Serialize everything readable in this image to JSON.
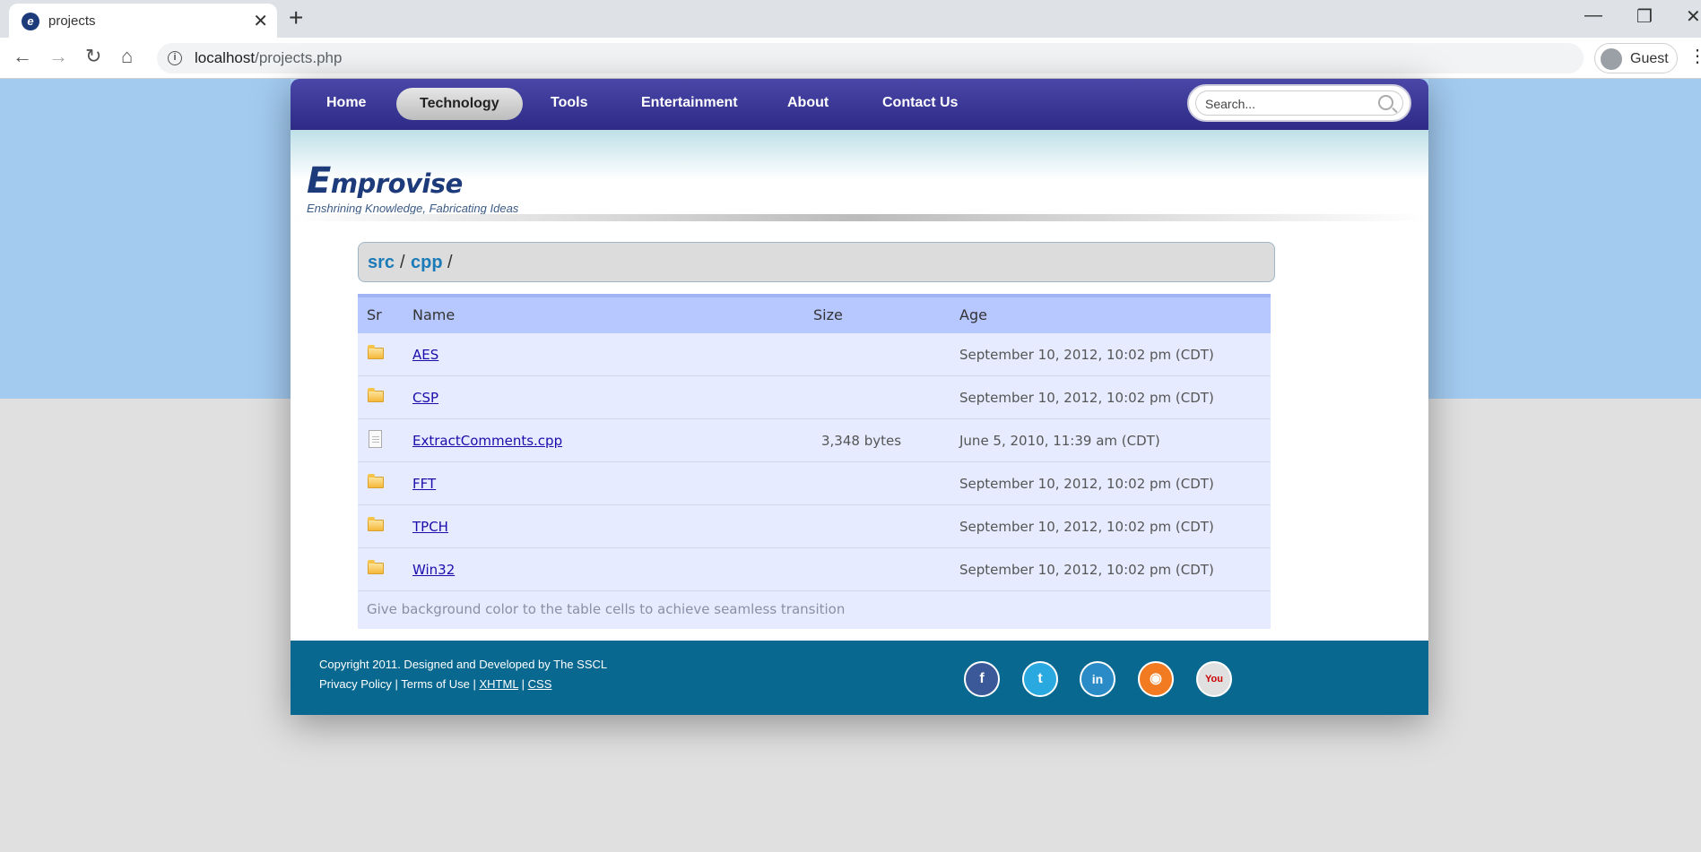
{
  "browser": {
    "tab_title": "projects",
    "favicon_letter": "e",
    "new_tab": "+",
    "url_host": "localhost",
    "url_path": "/projects.php",
    "profile_label": "Guest",
    "back": "←",
    "forward": "→",
    "reload": "↻",
    "home": "⌂",
    "close": "✕",
    "minimize": "—",
    "restore": "❐",
    "window_close": "✕",
    "menu": "⋮",
    "info": "i"
  },
  "nav": {
    "items": [
      "Home",
      "Technology",
      "Tools",
      "Entertainment",
      "About",
      "Contact Us"
    ],
    "active": "Technology",
    "search_placeholder": "Search..."
  },
  "header": {
    "logo_first": "E",
    "logo_rest": "mprovise",
    "tagline": "Enshrining Knowledge, Fabricating Ideas"
  },
  "breadcrumb": {
    "parts": [
      "src",
      "cpp"
    ],
    "separator": "/"
  },
  "table": {
    "headers": {
      "sr": "Sr",
      "name": "Name",
      "size": "Size",
      "age": "Age"
    },
    "rows": [
      {
        "type": "folder",
        "name": "AES",
        "size": "",
        "age": "September 10, 2012, 10:02 pm (CDT)"
      },
      {
        "type": "folder",
        "name": "CSP",
        "size": "",
        "age": "September 10, 2012, 10:02 pm (CDT)"
      },
      {
        "type": "file",
        "name": "ExtractComments.cpp",
        "size": "3,348 bytes",
        "age": "June 5, 2010, 11:39 am (CDT)"
      },
      {
        "type": "folder",
        "name": "FFT",
        "size": "",
        "age": "September 10, 2012, 10:02 pm (CDT)"
      },
      {
        "type": "folder",
        "name": "TPCH",
        "size": "",
        "age": "September 10, 2012, 10:02 pm (CDT)"
      },
      {
        "type": "folder",
        "name": "Win32",
        "size": "",
        "age": "September 10, 2012, 10:02 pm (CDT)"
      }
    ],
    "footer_note": "Give background color to the table cells to achieve seamless transition"
  },
  "footer": {
    "copyright": "Copyright 2011. Designed and Developed by The SSCL",
    "privacy": "Privacy Policy",
    "terms": "Terms of Use",
    "xhtml": "XHTML",
    "css": "CSS",
    "sep": " | ",
    "social": [
      {
        "name": "facebook",
        "glyph": "f",
        "color": "#3b5998"
      },
      {
        "name": "twitter",
        "glyph": "t",
        "color": "#2aa9e0"
      },
      {
        "name": "linkedin",
        "glyph": "in",
        "color": "#2a8bc6"
      },
      {
        "name": "rss",
        "glyph": "◉",
        "color": "#f27b21"
      },
      {
        "name": "youtube",
        "glyph": "You",
        "color": "#e0e0e0"
      }
    ]
  }
}
